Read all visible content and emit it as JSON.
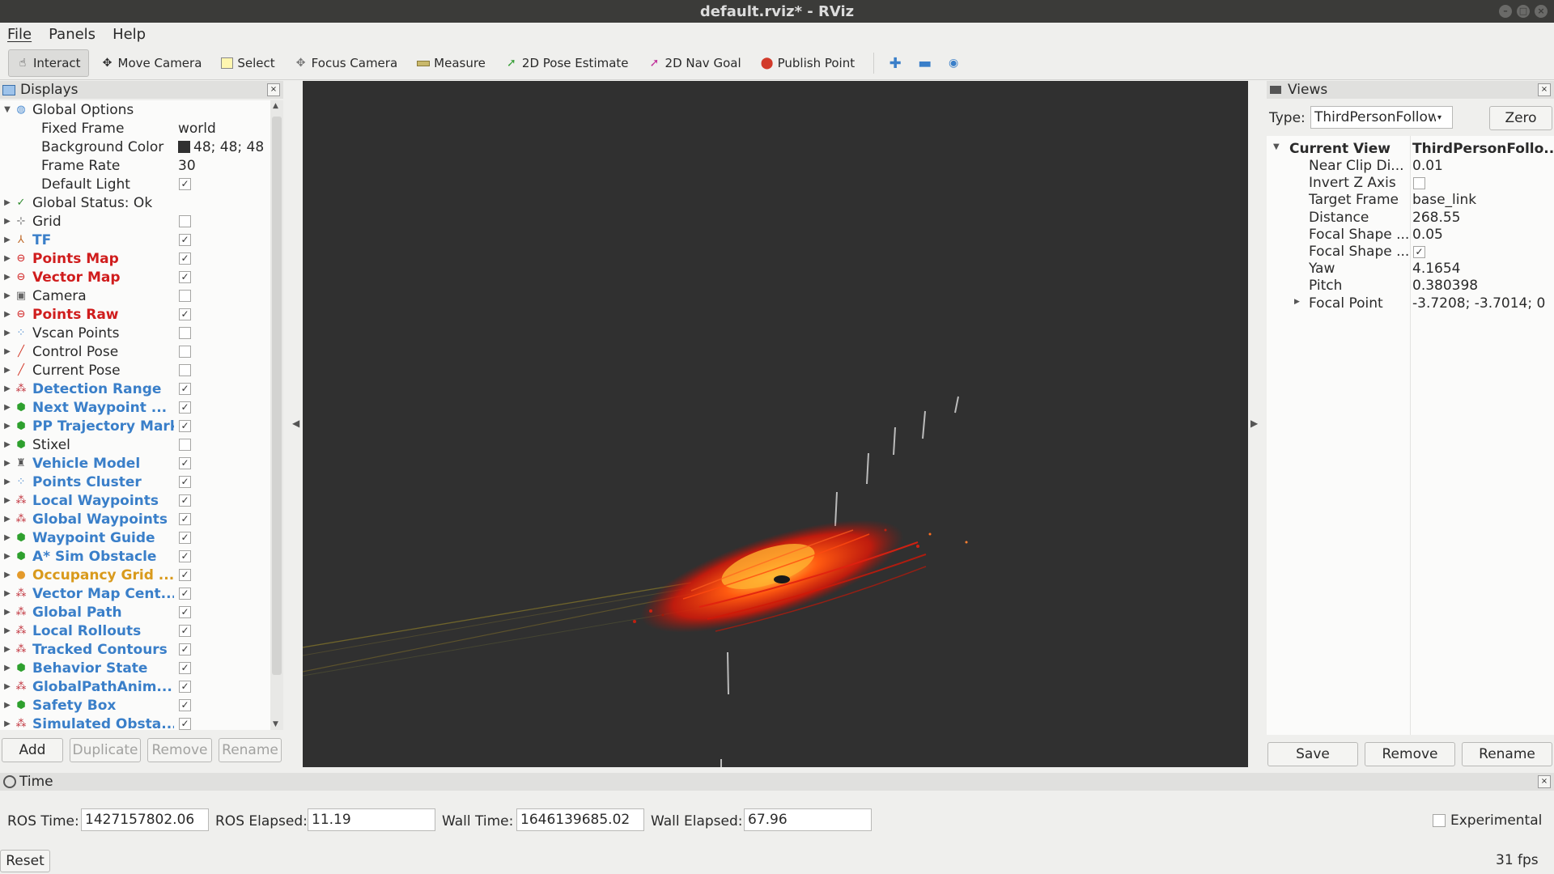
{
  "window": {
    "title": "default.rviz* - RViz"
  },
  "menu": [
    "File",
    "Panels",
    "Help"
  ],
  "toolbar": {
    "tools": [
      {
        "label": "Interact",
        "icon": "interact-icon",
        "active": true
      },
      {
        "label": "Move Camera",
        "icon": "move-camera-icon"
      },
      {
        "label": "Select",
        "icon": "select-icon"
      },
      {
        "label": "Focus Camera",
        "icon": "focus-camera-icon"
      },
      {
        "label": "Measure",
        "icon": "measure-icon"
      },
      {
        "label": "2D Pose Estimate",
        "icon": "pose-estimate-icon"
      },
      {
        "label": "2D Nav Goal",
        "icon": "nav-goal-icon"
      },
      {
        "label": "Publish Point",
        "icon": "publish-point-icon"
      }
    ]
  },
  "displays": {
    "title": "Displays",
    "global_options": {
      "label": "Global Options"
    },
    "props": [
      {
        "name": "Fixed Frame",
        "value": "world"
      },
      {
        "name": "Background Color",
        "value": "48; 48; 48",
        "color": "#303030"
      },
      {
        "name": "Frame Rate",
        "value": "30"
      },
      {
        "name": "Default Light",
        "checked": true
      }
    ],
    "items": [
      {
        "name": "Global Status: Ok",
        "icon": "check-icon",
        "color": "#2a2a2a",
        "bold": false
      },
      {
        "name": "Grid",
        "icon": "grid-icon",
        "color": "#2a2a2a",
        "bold": false,
        "checked": false
      },
      {
        "name": "TF",
        "icon": "tf-icon",
        "color": "#3a7fc9",
        "bold": true,
        "checked": true
      },
      {
        "name": "Points Map",
        "icon": "error-icon",
        "color": "#d01d1d",
        "bold": true,
        "checked": true
      },
      {
        "name": "Vector Map",
        "icon": "error-icon",
        "color": "#d01d1d",
        "bold": true,
        "checked": true
      },
      {
        "name": "Camera",
        "icon": "camera-icon",
        "color": "#2a2a2a",
        "bold": false,
        "checked": false
      },
      {
        "name": "Points Raw",
        "icon": "error-icon",
        "color": "#d01d1d",
        "bold": true,
        "checked": true
      },
      {
        "name": "Vscan Points",
        "icon": "points-icon",
        "color": "#2a2a2a",
        "bold": false,
        "checked": false
      },
      {
        "name": "Control Pose",
        "icon": "pose-icon",
        "color": "#2a2a2a",
        "bold": false,
        "checked": false
      },
      {
        "name": "Current Pose",
        "icon": "pose-icon",
        "color": "#2a2a2a",
        "bold": false,
        "checked": false
      },
      {
        "name": "Detection Range",
        "icon": "marker-array-icon",
        "color": "#3a7fc9",
        "bold": true,
        "checked": true
      },
      {
        "name": "Next Waypoint ...",
        "icon": "marker-icon",
        "color": "#3a7fc9",
        "bold": true,
        "checked": true
      },
      {
        "name": "PP Trajectory Mark",
        "icon": "marker-icon",
        "color": "#3a7fc9",
        "bold": true,
        "checked": true
      },
      {
        "name": "Stixel",
        "icon": "marker-icon",
        "color": "#2a2a2a",
        "bold": false,
        "checked": false
      },
      {
        "name": "Vehicle Model",
        "icon": "robot-model-icon",
        "color": "#3a7fc9",
        "bold": true,
        "checked": true
      },
      {
        "name": "Points Cluster",
        "icon": "points-icon",
        "color": "#3a7fc9",
        "bold": true,
        "checked": true
      },
      {
        "name": "Local Waypoints",
        "icon": "marker-array-icon",
        "color": "#3a7fc9",
        "bold": true,
        "checked": true
      },
      {
        "name": "Global Waypoints",
        "icon": "marker-array-icon",
        "color": "#3a7fc9",
        "bold": true,
        "checked": true
      },
      {
        "name": "Waypoint Guide",
        "icon": "marker-icon",
        "color": "#3a7fc9",
        "bold": true,
        "checked": true
      },
      {
        "name": "A* Sim Obstacle",
        "icon": "marker-icon",
        "color": "#3a7fc9",
        "bold": true,
        "checked": true
      },
      {
        "name": "Occupancy Grid ...",
        "icon": "warning-icon",
        "color": "#d99a1c",
        "bold": true,
        "checked": true
      },
      {
        "name": "Vector Map Cent...",
        "icon": "marker-array-icon",
        "color": "#3a7fc9",
        "bold": true,
        "checked": true
      },
      {
        "name": "Global Path",
        "icon": "marker-array-icon",
        "color": "#3a7fc9",
        "bold": true,
        "checked": true
      },
      {
        "name": "Local Rollouts",
        "icon": "marker-array-icon",
        "color": "#3a7fc9",
        "bold": true,
        "checked": true
      },
      {
        "name": "Tracked Contours",
        "icon": "marker-array-icon",
        "color": "#3a7fc9",
        "bold": true,
        "checked": true
      },
      {
        "name": "Behavior State",
        "icon": "marker-icon",
        "color": "#3a7fc9",
        "bold": true,
        "checked": true
      },
      {
        "name": "GlobalPathAnim...",
        "icon": "marker-array-icon",
        "color": "#3a7fc9",
        "bold": true,
        "checked": true
      },
      {
        "name": "Safety Box",
        "icon": "marker-icon",
        "color": "#3a7fc9",
        "bold": true,
        "checked": true
      },
      {
        "name": "Simulated Obsta...",
        "icon": "marker-array-icon",
        "color": "#3a7fc9",
        "bold": true,
        "checked": true
      }
    ],
    "buttons": {
      "add": "Add",
      "duplicate": "Duplicate",
      "remove": "Remove",
      "rename": "Rename"
    }
  },
  "views": {
    "title": "Views",
    "type_label": "Type:",
    "type_value": "ThirdPersonFollower (r",
    "zero": "Zero",
    "current_view": {
      "label": "Current View",
      "value": "ThirdPersonFollo..."
    },
    "props": [
      {
        "name": "Near Clip Di...",
        "value": "0.01"
      },
      {
        "name": "Invert Z Axis",
        "checked": false
      },
      {
        "name": "Target Frame",
        "value": "base_link"
      },
      {
        "name": "Distance",
        "value": "268.55"
      },
      {
        "name": "Focal Shape ...",
        "value": "0.05"
      },
      {
        "name": "Focal Shape ...",
        "checked": true
      },
      {
        "name": "Yaw",
        "value": "4.1654"
      },
      {
        "name": "Pitch",
        "value": "0.380398"
      },
      {
        "name": "Focal Point",
        "value": "-3.7208; -3.7014; 0",
        "expandable": true
      }
    ],
    "buttons": {
      "save": "Save",
      "remove": "Remove",
      "rename": "Rename"
    }
  },
  "time": {
    "title": "Time",
    "ros_time_label": "ROS Time:",
    "ros_time": "1427157802.06",
    "ros_elapsed_label": "ROS Elapsed:",
    "ros_elapsed": "11.19",
    "wall_time_label": "Wall Time:",
    "wall_time": "1646139685.02",
    "wall_elapsed_label": "Wall Elapsed:",
    "wall_elapsed": "67.96",
    "experimental": "Experimental",
    "reset": "Reset",
    "fps": "31 fps"
  },
  "colors": {
    "viewport_bg": "#303030",
    "pointcloud_hot": "#ff3a10",
    "pointcloud_warm": "#ffb030"
  }
}
